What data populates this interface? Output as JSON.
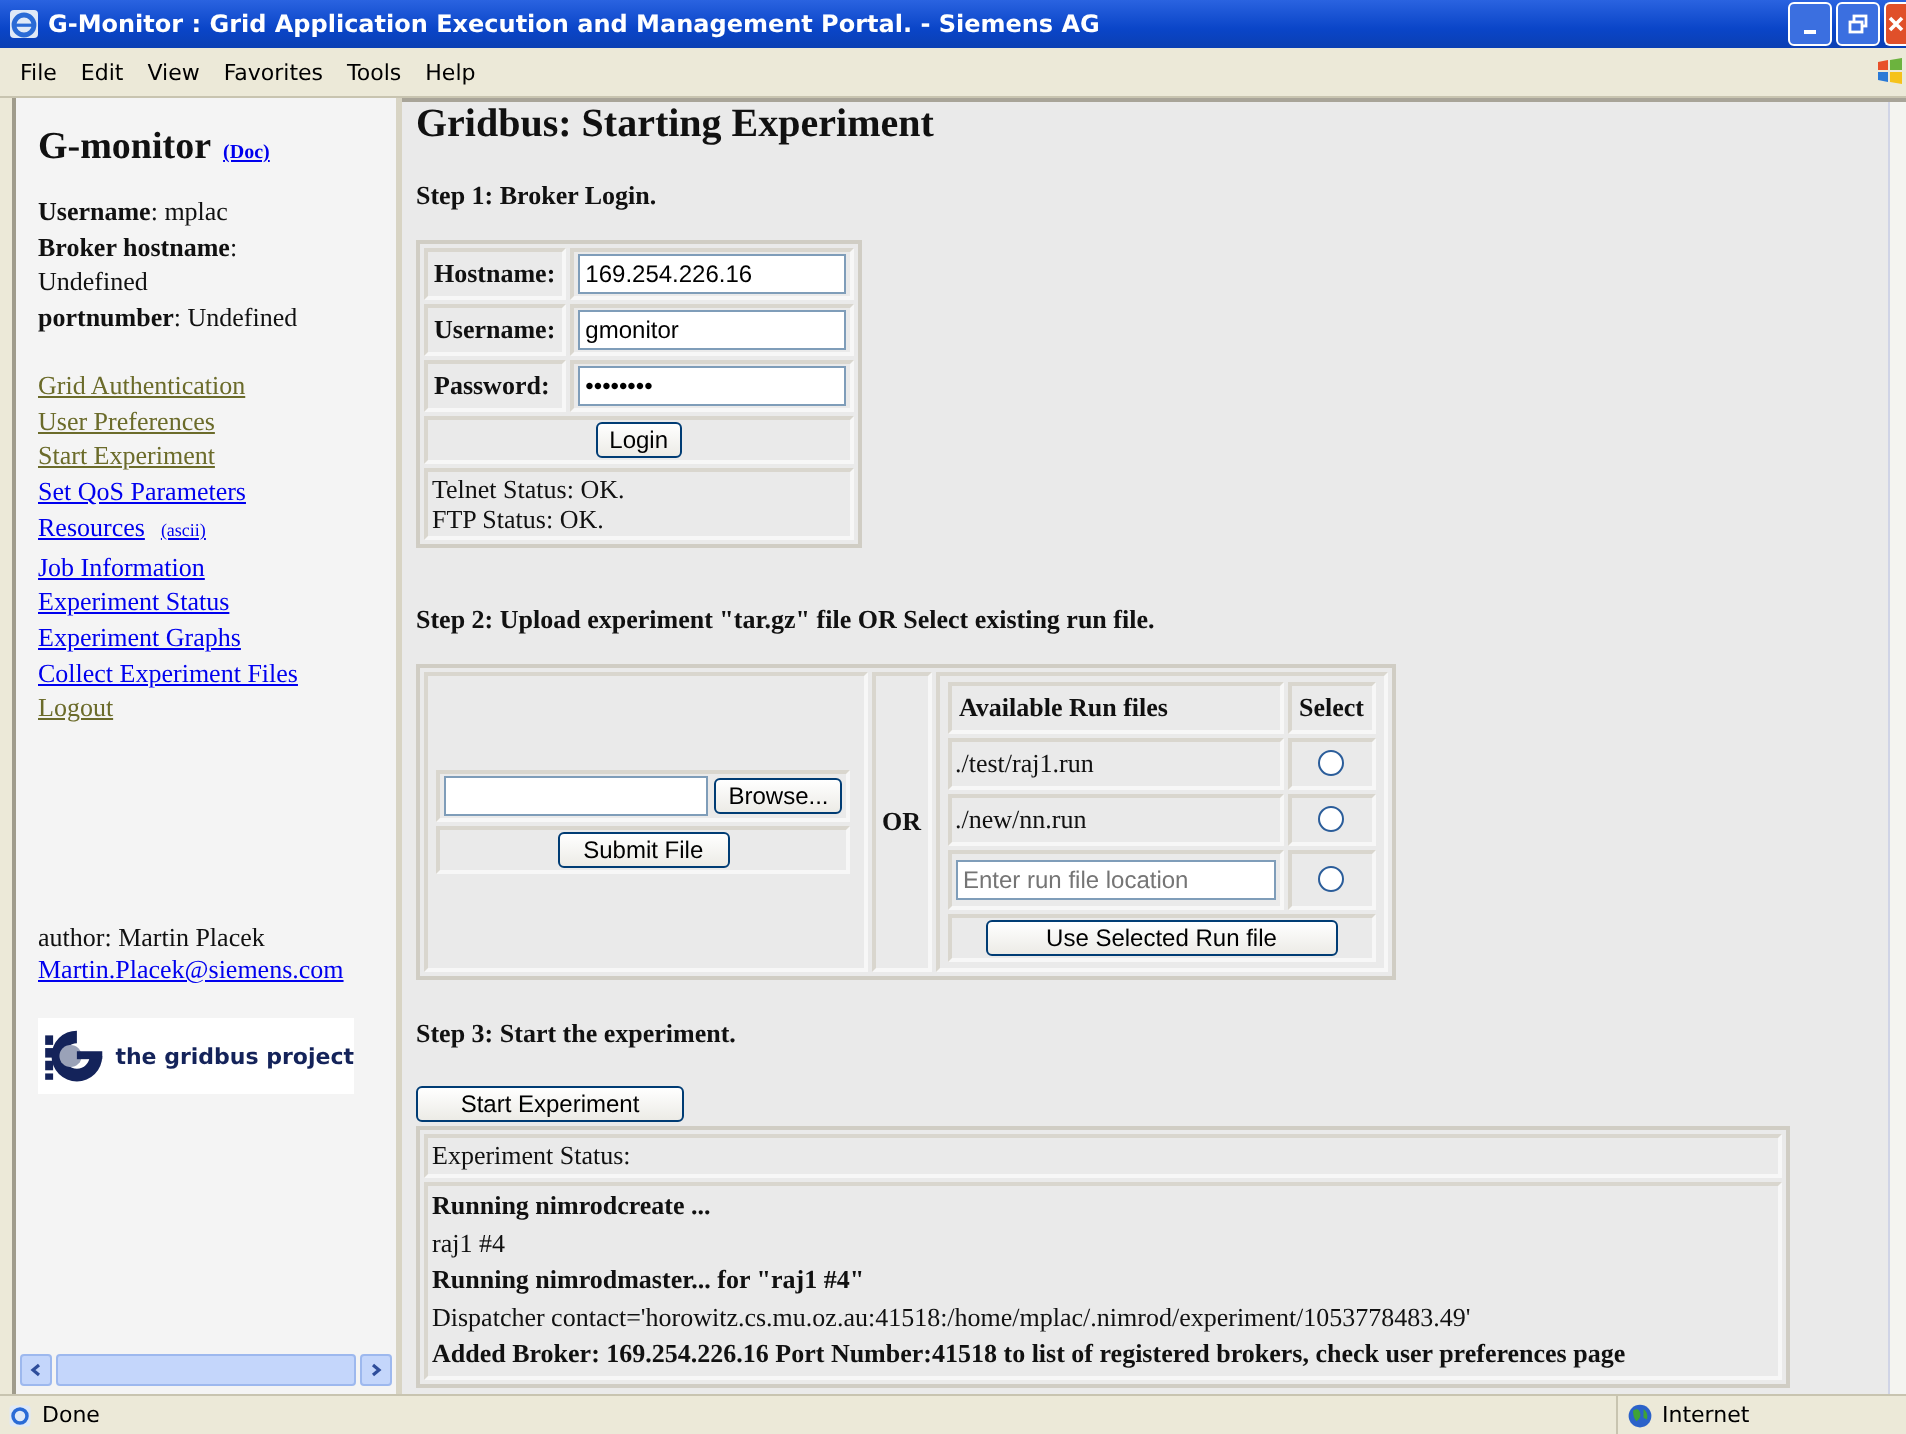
{
  "window": {
    "title": "G-Monitor : Grid Application Execution and Management Portal. - Siemens AG"
  },
  "menu": [
    "File",
    "Edit",
    "View",
    "Favorites",
    "Tools",
    "Help"
  ],
  "sidebar": {
    "title": "G-monitor",
    "doc_link": "(Doc)",
    "info": [
      "**Username**: mplac",
      "**Broker hostname**: Undefined",
      "**portnumber**: Undefined"
    ],
    "links": [
      {
        "label": "Grid Authentication",
        "visited": true
      },
      {
        "label": "User Preferences",
        "visited": true
      },
      {
        "label": "Start Experiment",
        "visited": true
      },
      {
        "label": "Set QoS Parameters",
        "visited": false
      },
      {
        "label": "Resources",
        "visited": false,
        "sub_link": "(ascii)"
      },
      {
        "label": "Job Information",
        "visited": false
      },
      {
        "label": "Experiment Status",
        "visited": false
      },
      {
        "label": "Experiment Graphs",
        "visited": false
      },
      {
        "label": "Collect Experiment Files",
        "visited": false
      },
      {
        "label": "Logout",
        "visited": true
      }
    ],
    "author": "author: Martin Placek",
    "email": "Martin.Placek@siemens.com",
    "logo_text": "the gridbus project"
  },
  "page": {
    "heading": "Gridbus: Starting Experiment",
    "step1": {
      "label": "Step 1: Broker Login.",
      "fields": [
        {
          "label": "Hostname:",
          "value": "169.254.226.16"
        },
        {
          "label": "Username:",
          "value": "gmonitor"
        },
        {
          "label": "Password:",
          "value": "••••••••"
        }
      ],
      "button": "Login",
      "status": [
        "Telnet Status: OK.",
        "FTP Status: OK."
      ]
    },
    "step2": {
      "label": "Step 2: Upload experiment \"tar.gz\" file OR Select existing run file.",
      "browse_button": "Browse...",
      "submit_button": "Submit File",
      "or": "OR",
      "columns": [
        "Available Run files",
        "Select"
      ],
      "run_files": [
        {
          "kind": "text",
          "label": "./test/raj1.run",
          "selected": false
        },
        {
          "kind": "text",
          "label": "./new/nn.run",
          "selected": false
        },
        {
          "kind": "input",
          "placeholder": "Enter run file location",
          "selected": false
        }
      ],
      "use_button": "Use Selected Run file"
    },
    "step3": {
      "label": "Step 3: Start the experiment.",
      "button": "Start Experiment",
      "status_title": "Experiment Status:",
      "lines": [
        {
          "kind": "heading",
          "text": "Running nimrodcreate ..."
        },
        {
          "kind": "output",
          "text": "raj1 #4"
        },
        {
          "kind": "heading",
          "text": "Running nimrodmaster... for \"raj1 #4\""
        },
        {
          "kind": "output",
          "text": "Dispatcher contact='horowitz.cs.mu.oz.au:41518:/home/mplac/.nimrod/experiment/1053778483.49'"
        },
        {
          "kind": "heading",
          "text": "Added Broker: 169.254.226.16 Port Number:41518 to list of registered brokers, check user preferences page"
        }
      ]
    }
  },
  "status_bar": {
    "text": "Done",
    "zone": "Internet"
  }
}
